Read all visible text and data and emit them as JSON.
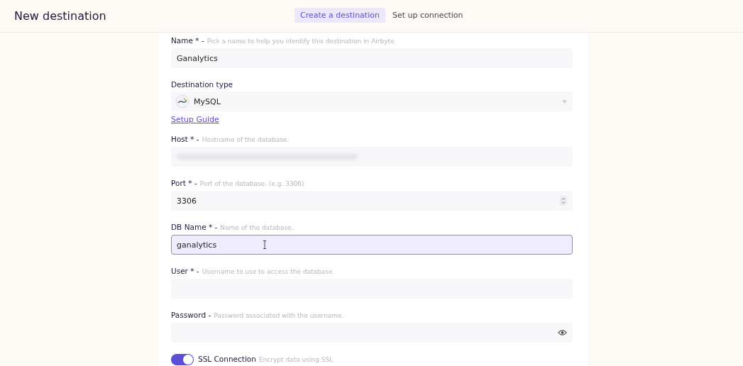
{
  "header": {
    "title": "New destination",
    "tabs": [
      {
        "label": "Create a destination",
        "selected": true
      },
      {
        "label": "Set up connection",
        "selected": false
      }
    ]
  },
  "fields": [
    {
      "kind": "text",
      "label": "Name * -",
      "description": "Pick a name to help you identify this destination in Airbyte",
      "value": "Ganalytics",
      "focused": false
    },
    {
      "kind": "select",
      "label": "Destination type",
      "value": "MySQL",
      "link": "Setup Guide"
    },
    {
      "kind": "masked",
      "label": "Host * -",
      "description": "Hostname of the database.",
      "focused": false
    },
    {
      "kind": "number",
      "label": "Port * -",
      "description": "Port of the database. (e.g. 3306)",
      "value": "3306",
      "focused": false
    },
    {
      "kind": "text",
      "label": "DB Name * -",
      "description": "Name of the database.",
      "value": "ganalytics",
      "focused": true
    },
    {
      "kind": "text",
      "label": "User * -",
      "description": "Username to use to access the database.",
      "focused": false
    },
    {
      "kind": "password",
      "label": "Password -",
      "description": "Password associated with the username.",
      "focused": false
    }
  ],
  "ssl": {
    "label": "SSL Connection",
    "description": "Encrypt data using SSL",
    "on": true
  }
}
